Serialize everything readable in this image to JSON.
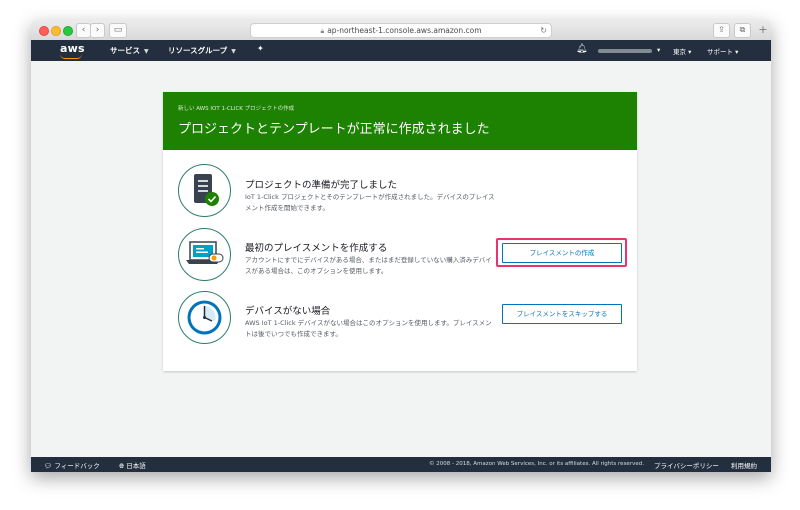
{
  "browser": {
    "url": "ap-northeast-1.console.aws.amazon.com"
  },
  "aws_nav": {
    "logo": "aws",
    "services": "サービス",
    "resource_groups": "リソースグループ",
    "region": "東京",
    "support": "サポート"
  },
  "banner": {
    "subtitle": "新しい AWS IOT 1-CLICK プロジェクトの作成",
    "title": "プロジェクトとテンプレートが正常に作成されました"
  },
  "steps": [
    {
      "title": "プロジェクトの準備が完了しました",
      "desc": "IoT 1-Click プロジェクトとそのテンプレートが作成されました。デバイスのプレイスメント作成を開始できます。",
      "icon": "checklist-icon"
    },
    {
      "title": "最初のプレイスメントを作成する",
      "desc": "アカウントにすでにデバイスがある場合、またはまだ登録していない購入済みデバイスがある場合は、このオプションを使用します。",
      "icon": "laptop-placement-icon",
      "button": "プレイスメントの作成"
    },
    {
      "title": "デバイスがない場合",
      "desc": "AWS IoT 1-Click デバイスがない場合はこのオプションを使用します。プレイスメントは後でいつでも作成できます。",
      "icon": "clock-icon",
      "button": "プレイスメントをスキップする"
    }
  ],
  "footer": {
    "feedback": "フィードバック",
    "language": "日本語",
    "copyright": "© 2008 - 2018, Amazon Web Services, Inc. or its affiliates. All rights reserved.",
    "privacy": "プライバシーポリシー",
    "terms": "利用規約"
  },
  "colors": {
    "banner": "#1d8102",
    "nav": "#232f3e",
    "link": "#0073bb",
    "highlight": "#e8356d"
  }
}
